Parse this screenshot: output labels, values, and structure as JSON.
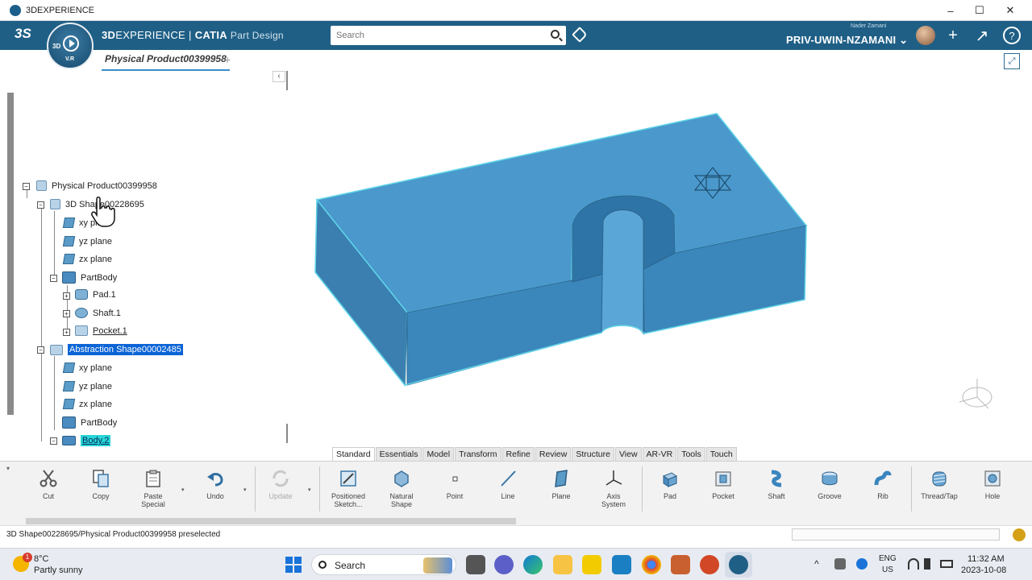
{
  "window": {
    "title": "3DEXPERIENCE",
    "controls": {
      "minimize": "–",
      "maximize": "☐",
      "close": "✕"
    }
  },
  "header": {
    "ds_logo": "3S",
    "compass": {
      "label_3d": "3D",
      "label_vr": "V.R"
    },
    "brand_bold": "3D",
    "brand_rest": "EXPERIENCE",
    "brand_sep": "|",
    "brand_product": "CATIA",
    "brand_app": "Part Design",
    "search_placeholder": "Search",
    "user_small": "Nader Zamani",
    "user_name": "PRIV-UWIN-NZAMANI",
    "user_chevron": "⌄",
    "plus": "+",
    "share": "↗",
    "help": "?"
  },
  "tabs": {
    "document": "Physical Product00399958",
    "add": "+"
  },
  "tree": {
    "collapse_label": "‹",
    "nodes": [
      {
        "label": "Physical Product00399958",
        "icon": "product-icon"
      },
      {
        "label": "3D Shape00228695",
        "icon": "shape-icon"
      },
      {
        "label": "xy plane",
        "icon": "plane-icon"
      },
      {
        "label": "yz plane",
        "icon": "plane-icon"
      },
      {
        "label": "zx plane",
        "icon": "plane-icon"
      },
      {
        "label": "PartBody",
        "icon": "body-icon"
      },
      {
        "label": "Pad.1",
        "icon": "pad-icon"
      },
      {
        "label": "Shaft.1",
        "icon": "shaft-icon"
      },
      {
        "label": "Pocket.1",
        "icon": "pocket-icon"
      },
      {
        "label": "Abstraction Shape00002485",
        "icon": "shape-icon"
      },
      {
        "label": "xy plane",
        "icon": "plane-icon"
      },
      {
        "label": "yz plane",
        "icon": "plane-icon"
      },
      {
        "label": "zx plane",
        "icon": "plane-icon"
      },
      {
        "label": "PartBody",
        "icon": "body-icon"
      },
      {
        "label": "Body.2",
        "icon": "body-icon"
      }
    ]
  },
  "section_tabs": [
    "Standard",
    "Essentials",
    "Model",
    "Transform",
    "Refine",
    "Review",
    "Structure",
    "View",
    "AR-VR",
    "Tools",
    "Touch"
  ],
  "actions": {
    "cut": "Cut",
    "copy": "Copy",
    "paste_special_1": "Paste",
    "paste_special_2": "Special",
    "undo": "Undo",
    "update": "Update",
    "positioned_sketch_1": "Positioned",
    "positioned_sketch_2": "Sketch...",
    "natural_shape_1": "Natural",
    "natural_shape_2": "Shape",
    "point": "Point",
    "line": "Line",
    "plane": "Plane",
    "axis_system_1": "Axis",
    "axis_system_2": "System",
    "pad": "Pad",
    "pocket": "Pocket",
    "shaft": "Shaft",
    "groove": "Groove",
    "rib": "Rib",
    "thread_tap": "Thread/Tap",
    "hole": "Hole",
    "dropdown": "▾"
  },
  "status": {
    "text": "3D Shape00228695/Physical Product00399958 preselected"
  },
  "taskbar": {
    "weather_badge": "1",
    "weather_temp": "8°C",
    "weather_desc": "Partly sunny",
    "search_label": "Search",
    "lang_1": "ENG",
    "lang_2": "US",
    "time": "11:32 AM",
    "date": "2023-10-08",
    "tray_chevron": "^"
  },
  "colors": {
    "header_bg": "#1f5f86",
    "part_face_top": "#4a98cc",
    "part_face_front": "#3a82b4",
    "part_edge": "#5fd4e8",
    "selection_blue": "#0a64d6",
    "selection_cyan": "#28d6d6"
  }
}
